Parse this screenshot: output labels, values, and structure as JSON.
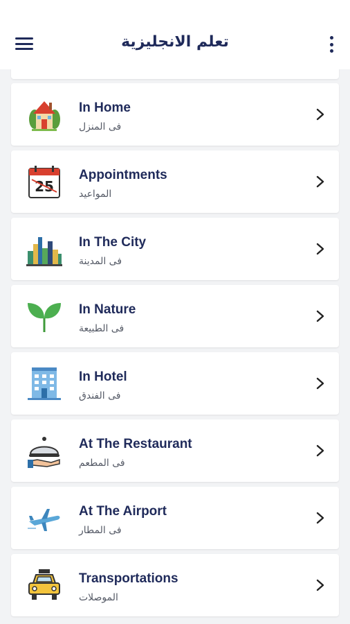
{
  "app_bar": {
    "title": "تعلم الانجليزية",
    "menu_icon": "hamburger-menu-icon",
    "more_icon": "more-vertical-icon"
  },
  "colors": {
    "title_text": "#1f2a5a",
    "background": "#f2f3f5",
    "card": "#ffffff"
  },
  "categories": [
    {
      "title": "In Home",
      "subtitle": "فى المنزل",
      "icon": "house-icon"
    },
    {
      "title": "Appointments",
      "subtitle": "المواعيد",
      "icon": "calendar-icon"
    },
    {
      "title": "In The City",
      "subtitle": "فى المدينة",
      "icon": "city-skyline-icon"
    },
    {
      "title": "In Nature",
      "subtitle": "فى الطبيعة",
      "icon": "sprout-icon"
    },
    {
      "title": "In Hotel",
      "subtitle": "فى الفندق",
      "icon": "hotel-icon"
    },
    {
      "title": "At The Restaurant",
      "subtitle": "فى المطعم",
      "icon": "serving-cloche-icon"
    },
    {
      "title": "At The Airport",
      "subtitle": "فى المطار",
      "icon": "airplane-icon"
    },
    {
      "title": "Transportations",
      "subtitle": "الموصلات",
      "icon": "taxi-icon"
    }
  ]
}
